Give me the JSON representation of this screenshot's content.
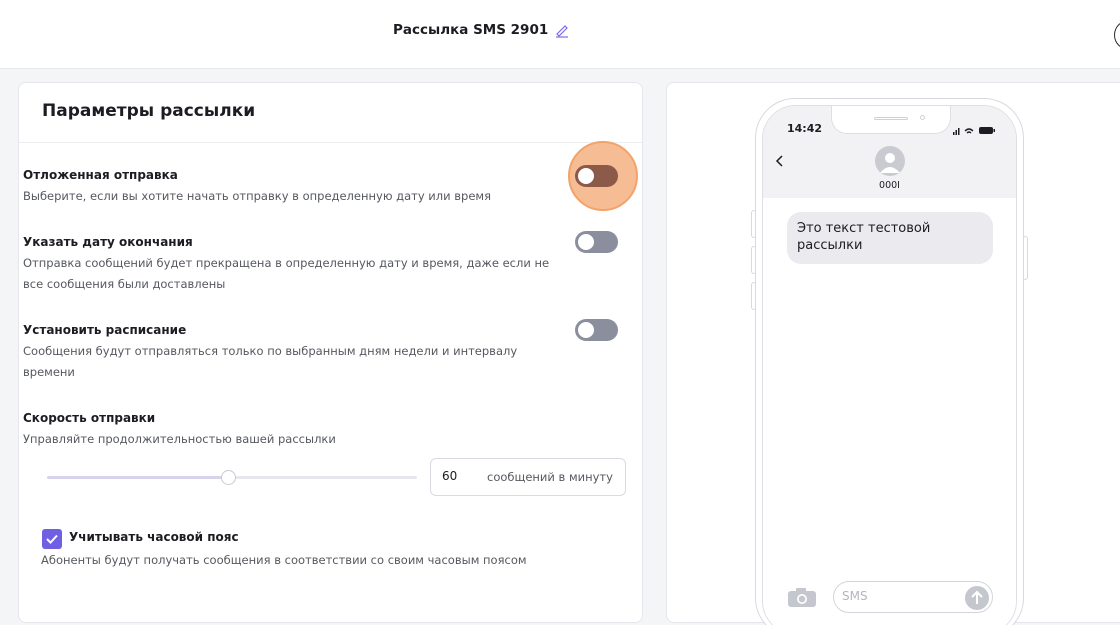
{
  "header": {
    "title": "Рассылка SMS 2901"
  },
  "panel": {
    "title": "Параметры рассылки",
    "options": [
      {
        "title": "Отложенная отправка",
        "description": "Выберите, если вы хотите начать отправку в определенную дату или время",
        "enabled": false
      },
      {
        "title": "Указать дату окончания",
        "description": "Отправка сообщений будет прекращена в определенную дату и время, даже если не все сообщения были доставлены",
        "enabled": false
      },
      {
        "title": "Установить расписание",
        "description": "Сообщения будут отправляться только по выбранным дням недели и интервалу времени",
        "enabled": false
      }
    ],
    "speed": {
      "title": "Скорость отправки",
      "description": "Управляйте продолжительностью вашей рассылки",
      "value": "60",
      "unit": "сообщений в минуту",
      "slider_fraction": 0.49
    },
    "timezone": {
      "label": "Учитывать часовой пояс",
      "description": "Абоненты будут получать сообщения в соответствии со своим часовым поясом",
      "checked": true
    }
  },
  "phone": {
    "time": "14:42",
    "contact": "000I",
    "message": "Это текст тестовой рассылки",
    "input_placeholder": "SMS"
  },
  "colors": {
    "accent": "#6f5fe3",
    "toggle_off": "#8b8f9d",
    "highlight": "#f6bc93"
  }
}
